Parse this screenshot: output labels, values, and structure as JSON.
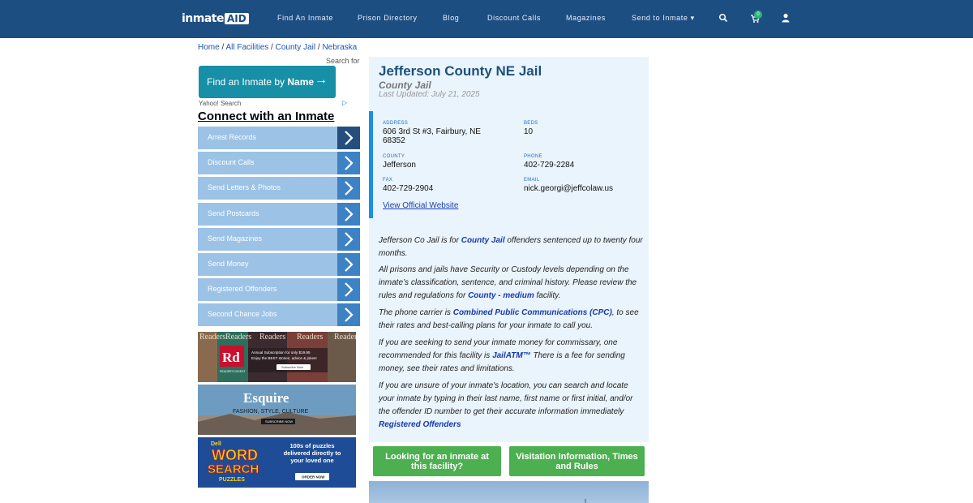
{
  "nav": {
    "logo_part1": "inmate",
    "logo_part2": "AID",
    "links": [
      "Find An Inmate",
      "Prison Directory",
      "Blog",
      "Discount Calls",
      "Magazines",
      "Send to Inmate"
    ],
    "dropdown_caret": "▾",
    "cart_count": "0",
    "icons": [
      "search-icon",
      "cart-icon",
      "user-icon"
    ]
  },
  "breadcrumb": [
    "Home",
    "All Facilities",
    "County Jail",
    "Nebraska"
  ],
  "breadcrumb_sep": " / ",
  "sidebar": {
    "search_for": "Search for",
    "yahoo_text_pre": "Find an Inmate by ",
    "yahoo_text_bold": "Name",
    "yahoo_arrow": "→",
    "yahoo_label": "Yahoo! Search",
    "adchoice": "▷",
    "connect_title": "Connect with an Inmate",
    "items": [
      "Arrest Records",
      "Discount Calls",
      "Send Letters & Photos",
      "Send Postcards",
      "Send Magazines",
      "Send Money",
      "Registered Offenders",
      "Second Chance Jobs"
    ],
    "ads": [
      {
        "brand": "Rd",
        "brand_sub": "READER'S DIGEST",
        "text": "Annual Subscription for only $19.95",
        "text2": "Enjoy the BEST stories, advice & jokes!",
        "cta": "Subscribe Now",
        "bg_word": "Readers"
      },
      {
        "brand": "Esquire",
        "text": "FASHION, STYLE, CULTURE",
        "cta": "SUBSCRIBE NOW"
      },
      {
        "brand": "Dell",
        "brand_main": "WORD",
        "brand_main2": "SEARCH",
        "brand_sub": "PUZZLES",
        "text": "100s of puzzles delivered directly to your loved one",
        "cta": "ORDER NOW"
      }
    ]
  },
  "facility": {
    "title": "Jefferson County NE Jail",
    "type": "County Jail",
    "updated": "Last Updated: July 21, 2025",
    "address_label": "ADDRESS",
    "address_line1": "606 3rd St #3, Fairbury, NE",
    "address_line2": "68352",
    "beds_label": "BEDS",
    "beds": "10",
    "county_label": "COUNTY",
    "county": "Jefferson",
    "phone_label": "PHONE",
    "phone": "402-729-2284",
    "fax_label": "FAX",
    "fax": "402-729-2904",
    "email_label": "EMAIL",
    "email": "nick.georgi@jeffcolaw.us",
    "website_link": "View Official Website"
  },
  "content": {
    "p1_a": "Jefferson Co Jail is for ",
    "p1_link": "County Jail",
    "p1_b": " offenders sentenced up to twenty four months.",
    "p2_a": "All prisons and jails have Security or Custody levels depending on the inmate’s classification, sentence, and criminal history. Please review the rules and regulations for ",
    "p2_link": "County - medium",
    "p2_b": " facility.",
    "p3_a": "The phone carrier is ",
    "p3_link": "Combined Public Communications (CPC)",
    "p3_b": ", to see their rates and best-calling plans for your inmate to call you.",
    "p4_a": "If you are seeking to send your inmate money for commissary, one recommended for this facility is ",
    "p4_link": "JailATM™",
    "p4_b": " There is a fee for sending money, see their rates and limitations.",
    "p5_a": "If you are unsure of your inmate's location, you can search and locate your inmate by typing in their last name, first name or first initial, and/or the offender ID number to get their accurate information immediately ",
    "p5_link": "Registered Offenders"
  },
  "buttons": {
    "looking": "Looking for an inmate at this facility?",
    "visitation": "Visitation Information, Times and Rules"
  },
  "colors": {
    "nav_bg": "#1d4e82",
    "menu_bg": "#9cc2e6",
    "menu_chevron": "#3d82c4",
    "green_button": "#4caf50",
    "panel_bg": "#eaf4fc",
    "accent_border": "#1d8fe1"
  }
}
